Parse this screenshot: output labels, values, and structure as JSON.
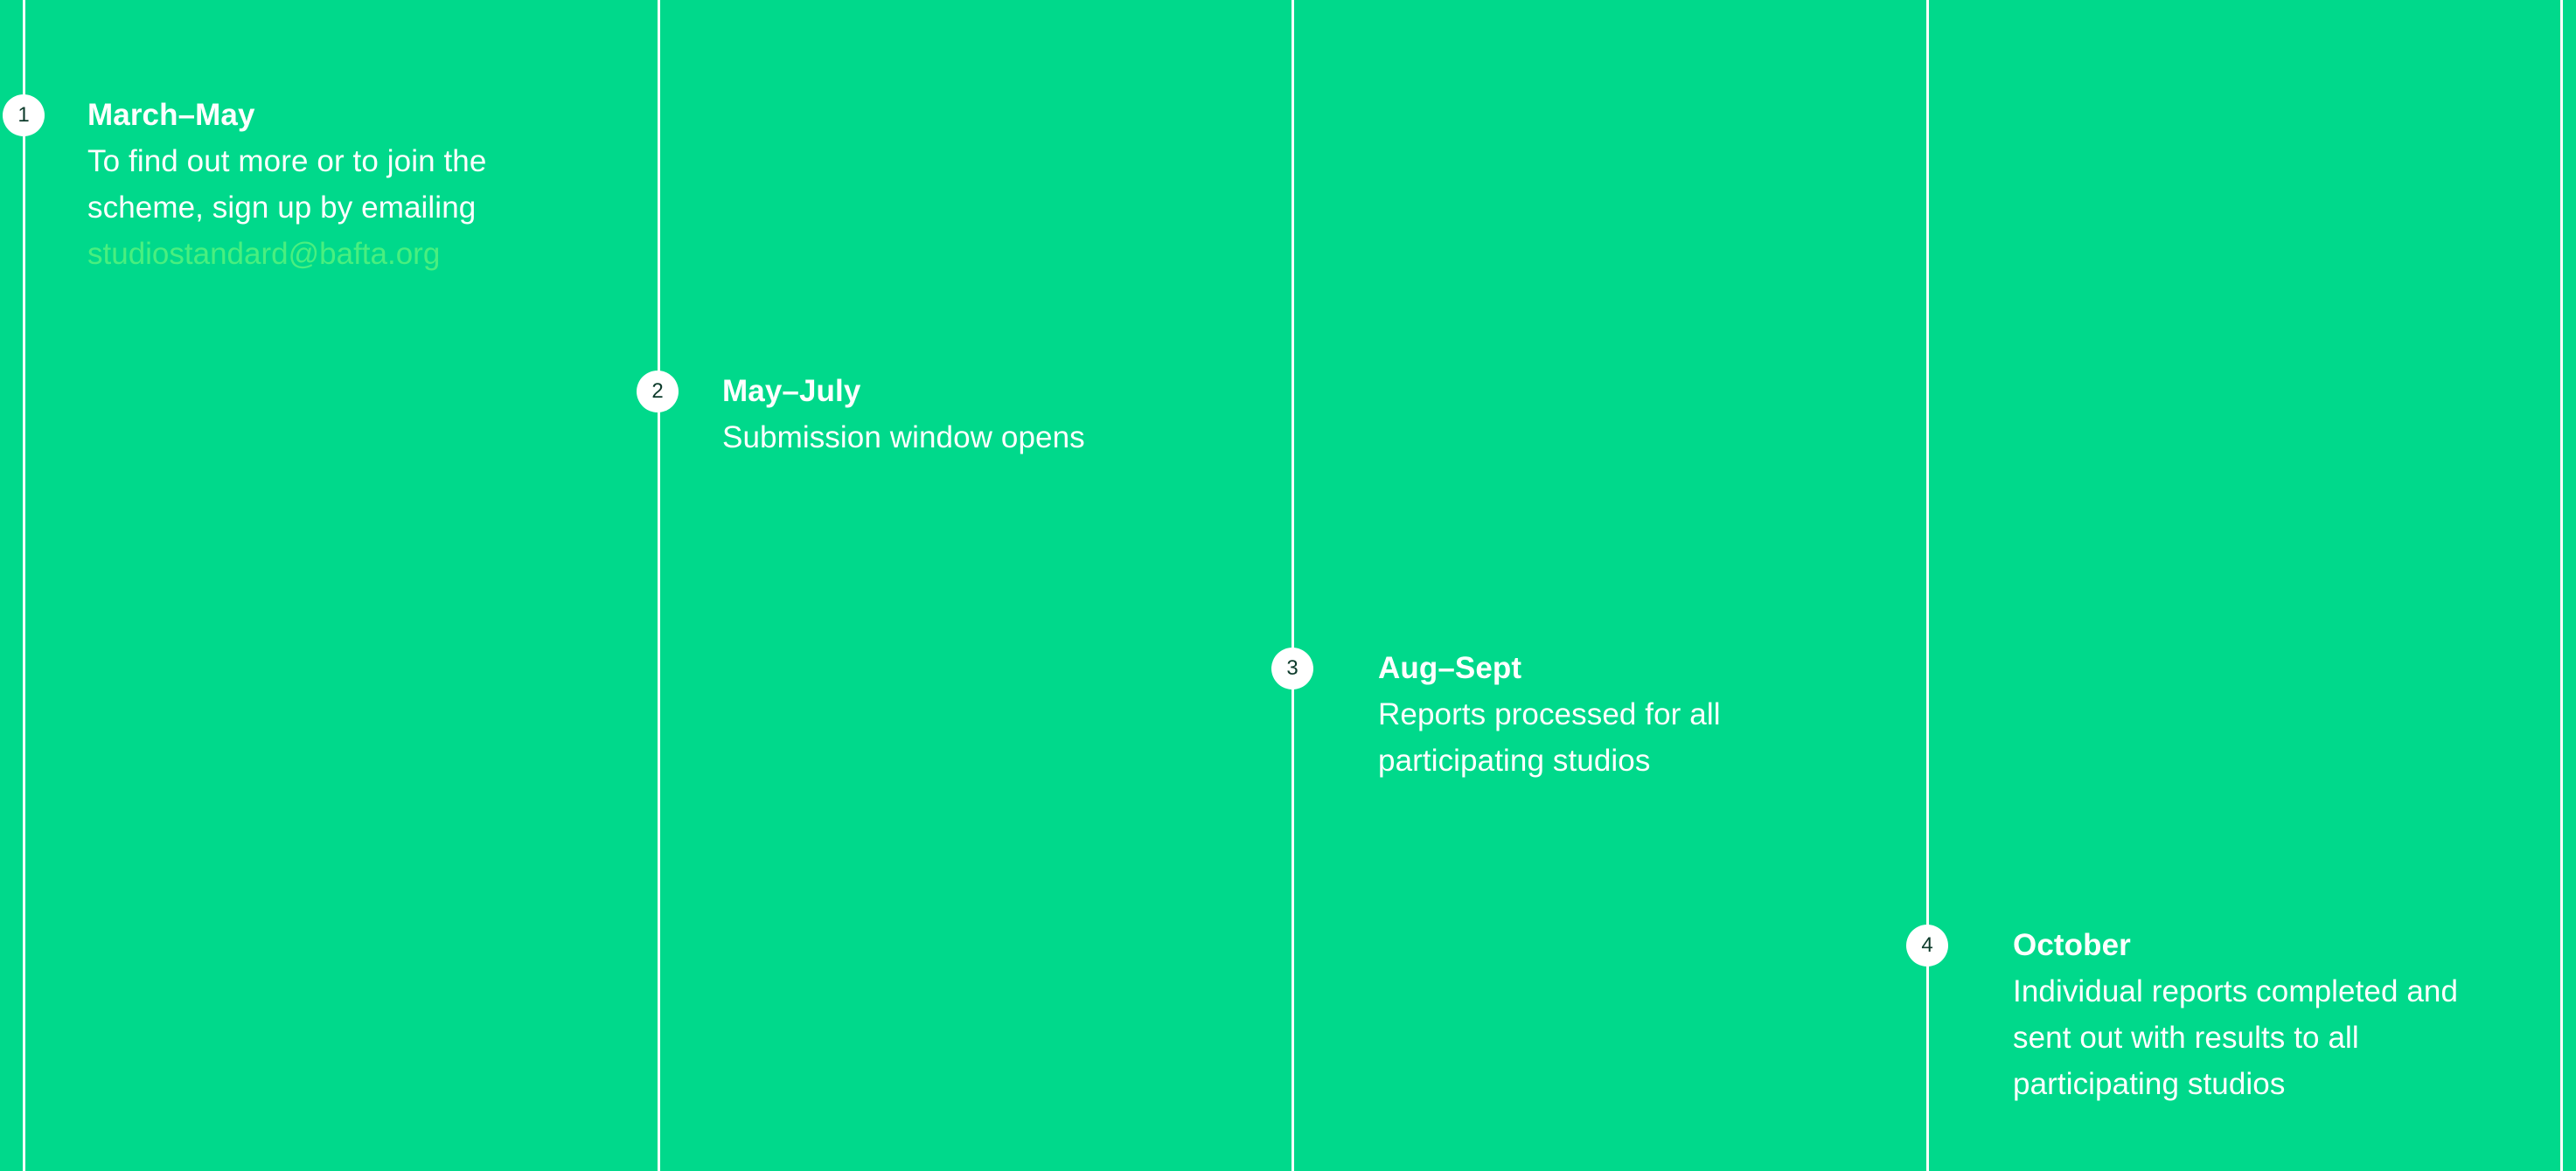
{
  "colors": {
    "background": "#00d98b",
    "line": "#ffffff",
    "badge_bg": "#ffffff",
    "badge_text": "#0d3b2b",
    "text": "#ffffff",
    "link": "#49ef7f"
  },
  "steps": [
    {
      "number": "1",
      "period": "March–May",
      "description": "To find out more or to join the scheme, sign up by emailing",
      "email": "studiostandard@bafta.org"
    },
    {
      "number": "2",
      "period": "May–July",
      "description": "Submission window opens"
    },
    {
      "number": "3",
      "period": "Aug–Sept",
      "description": "Reports processed for all participating studios"
    },
    {
      "number": "4",
      "period": "October",
      "description": "Individual reports completed and sent out with results to all participating studios"
    }
  ]
}
